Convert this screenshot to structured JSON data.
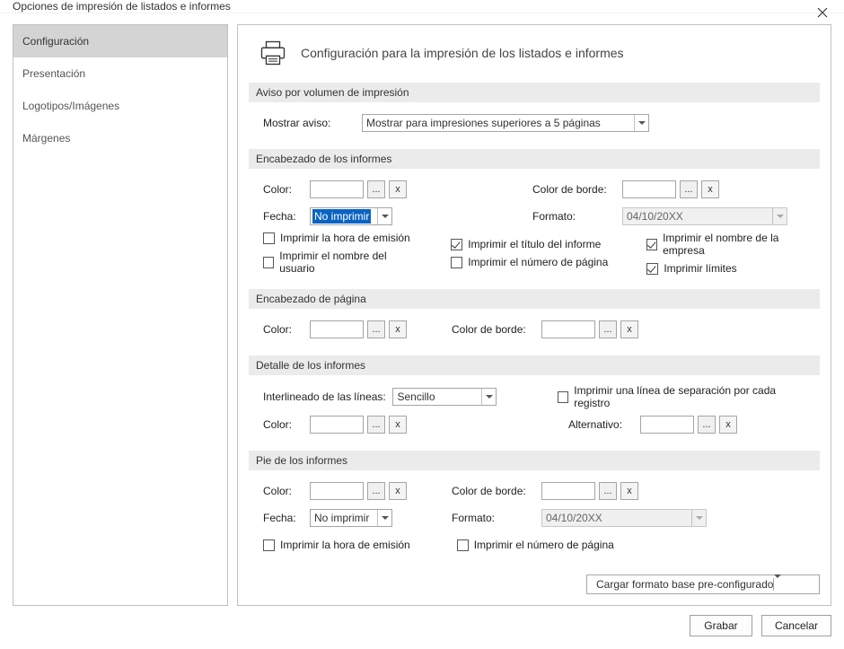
{
  "title": "Opciones de impresión de listados e informes",
  "sidebar": {
    "items": [
      {
        "label": "Configuración"
      },
      {
        "label": "Presentación"
      },
      {
        "label": "Logotipos/Imágenes"
      },
      {
        "label": "Márgenes"
      }
    ]
  },
  "header": {
    "title": "Configuración para la impresión de los listados e informes"
  },
  "sections": {
    "s1": {
      "title": "Aviso por volumen de impresión",
      "mostrar_label": "Mostrar aviso:",
      "mostrar_value": "Mostrar para impresiones superiores a 5 páginas"
    },
    "s2": {
      "title": "Encabezado de los informes",
      "color_label": "Color:",
      "fecha_label": "Fecha:",
      "fecha_value": "No imprimir",
      "color_borde_label": "Color de borde:",
      "formato_label": "Formato:",
      "formato_value": "04/10/20XX",
      "chk1": "Imprimir la hora de emisión",
      "chk2": "Imprimir el nombre del usuario",
      "chk3": "Imprimir el título del informe",
      "chk4": "Imprimir el número de página",
      "chk5": "Imprimir el nombre de la empresa",
      "chk6": "Imprimir límites"
    },
    "s3": {
      "title": "Encabezado de página",
      "color_label": "Color:",
      "color_borde_label": "Color de borde:"
    },
    "s4": {
      "title": "Detalle de los informes",
      "inter_label": "Interlineado de las líneas:",
      "inter_value": "Sencillo",
      "chk": "Imprimir una línea de separación por cada registro",
      "color_label": "Color:",
      "alt_label": "Alternativo:"
    },
    "s5": {
      "title": "Pie de los informes",
      "color_label": "Color:",
      "color_borde_label": "Color de borde:",
      "fecha_label": "Fecha:",
      "fecha_value": "No imprimir",
      "formato_label": "Formato:",
      "formato_value": "04/10/20XX",
      "chk1": "Imprimir la hora de emisión",
      "chk2": "Imprimir el número de página"
    }
  },
  "load_combo": "Cargar formato base pre-configurado",
  "buttons": {
    "save": "Grabar",
    "cancel": "Cancelar"
  },
  "mini": {
    "dots": "...",
    "x": "x"
  }
}
